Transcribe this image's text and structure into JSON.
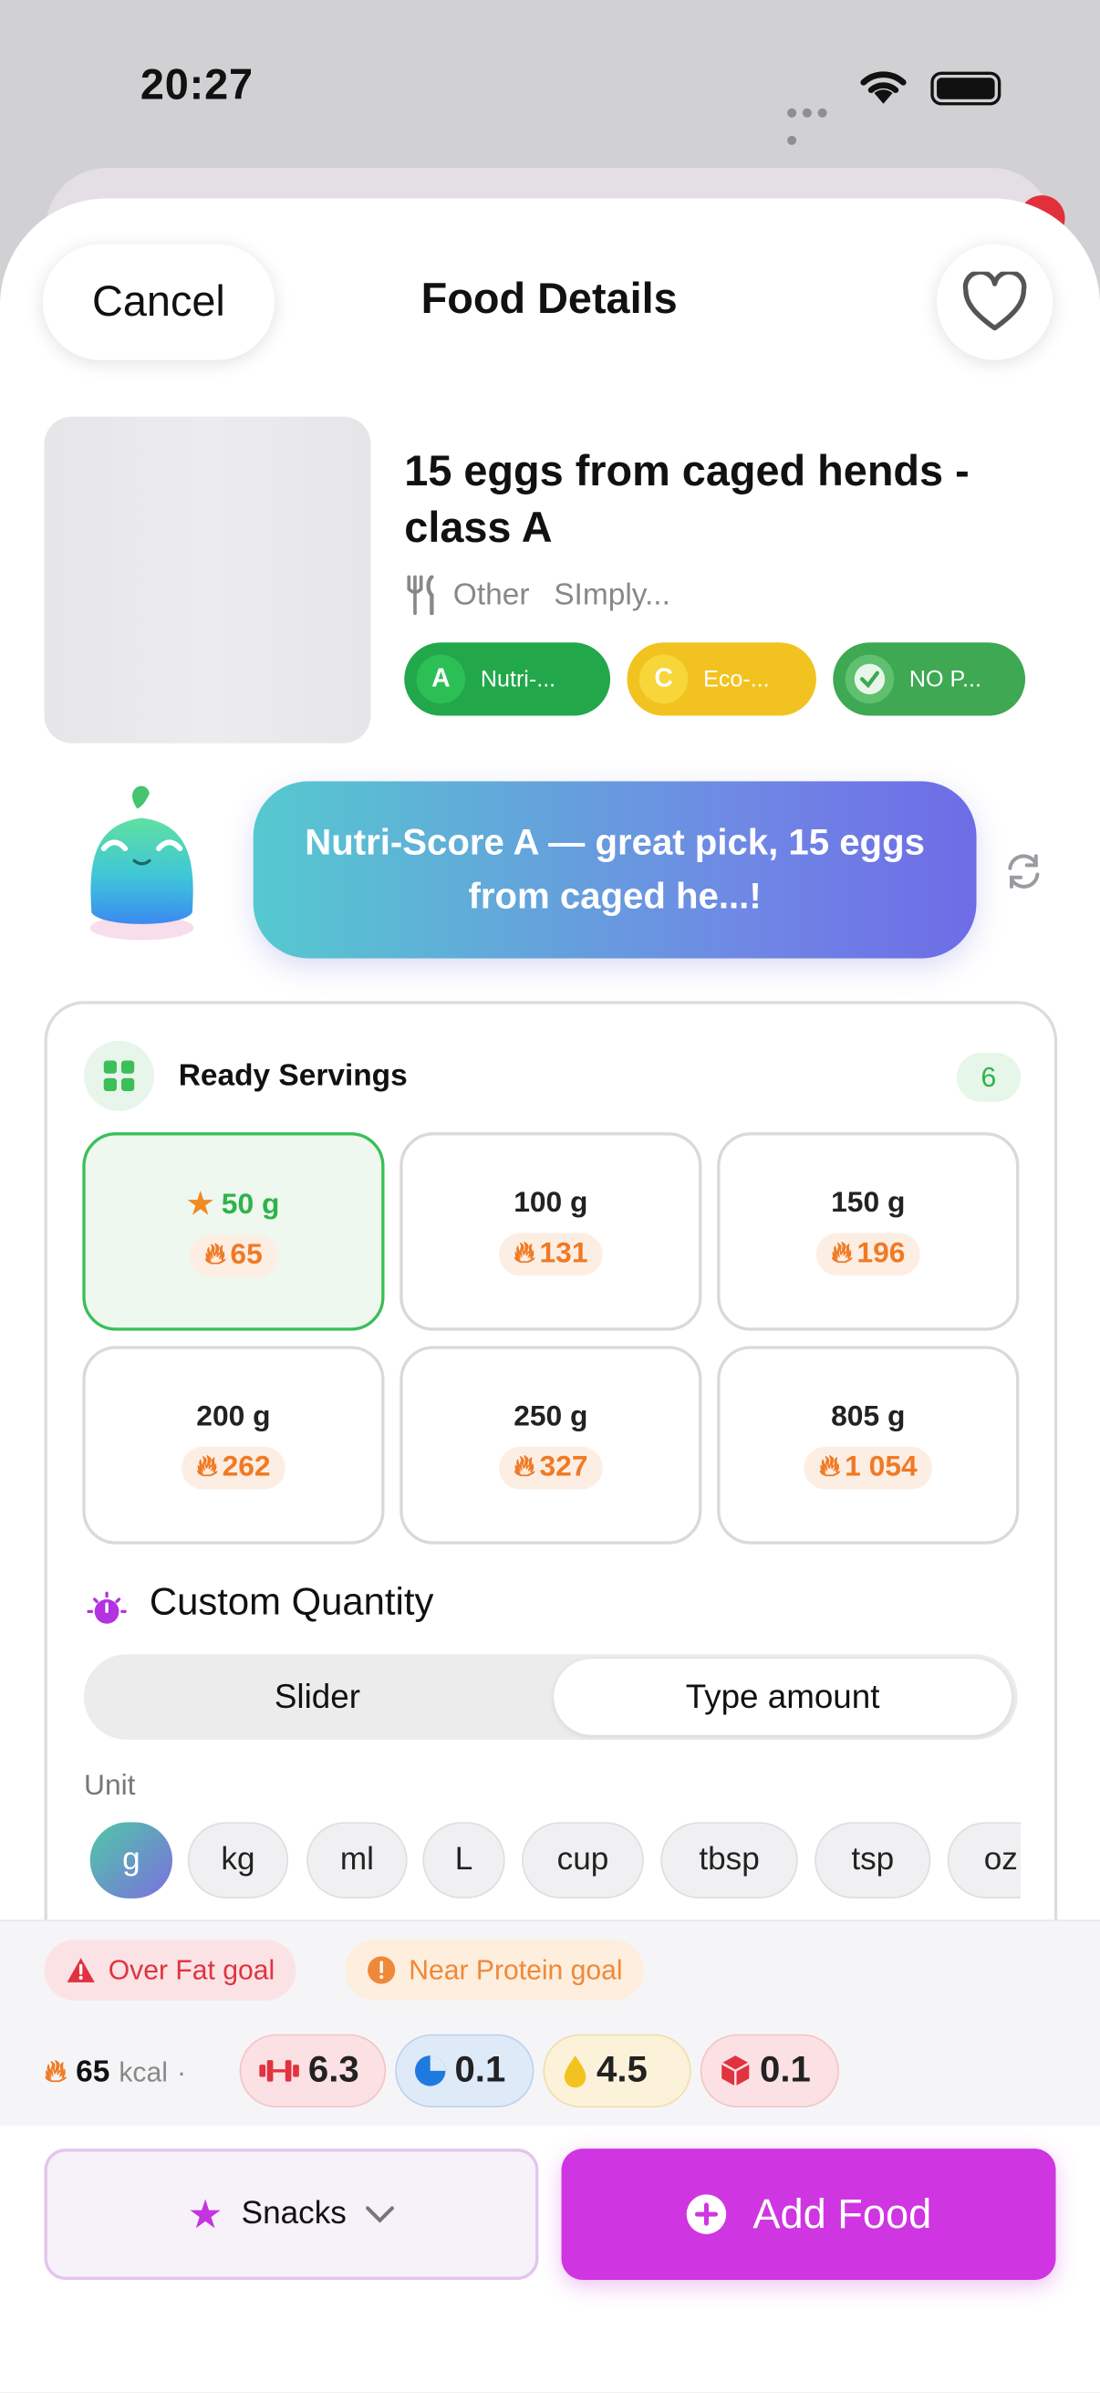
{
  "status_bar": {
    "time": "20:27"
  },
  "header": {
    "cancel_label": "Cancel",
    "title": "Food Details"
  },
  "food": {
    "name": "15 eggs from caged hends - class A",
    "category": "Other",
    "brand": "SImply...",
    "badges": [
      {
        "letter": "A",
        "label": "Nutri-..."
      },
      {
        "letter": "C",
        "label": "Eco-..."
      },
      {
        "letter": "",
        "label": "NO P..."
      }
    ]
  },
  "assistant": {
    "message": "Nutri-Score A — great pick, 15 eggs from caged he...!"
  },
  "servings": {
    "label": "Ready Servings",
    "count": "6",
    "items": [
      {
        "grams": "50 g",
        "kcal": "65",
        "selected": true
      },
      {
        "grams": "100 g",
        "kcal": "131",
        "selected": false
      },
      {
        "grams": "150 g",
        "kcal": "196",
        "selected": false
      },
      {
        "grams": "200 g",
        "kcal": "262",
        "selected": false
      },
      {
        "grams": "250 g",
        "kcal": "327",
        "selected": false
      },
      {
        "grams": "805 g",
        "kcal": "1 054",
        "selected": false
      }
    ]
  },
  "custom_quantity": {
    "label": "Custom Quantity",
    "modes": [
      "Slider",
      "Type amount"
    ],
    "selected_mode": "Type amount",
    "unit_label": "Unit",
    "units": [
      "g",
      "kg",
      "ml",
      "L",
      "cup",
      "tbsp",
      "tsp",
      "oz"
    ],
    "selected_unit": "g"
  },
  "summary": {
    "warnings": [
      "Over Fat goal",
      "Near Protein goal"
    ],
    "kcal_value": "65",
    "kcal_unit": "kcal",
    "macros": [
      "6.3",
      "0.1",
      "4.5",
      "0.1"
    ]
  },
  "footer": {
    "meal_label": "Snacks",
    "add_label": "Add Food"
  },
  "colors": {
    "accent": "#cf35e0",
    "green": "#3bbf58",
    "orange": "#f07a24",
    "red": "#e0333f"
  }
}
